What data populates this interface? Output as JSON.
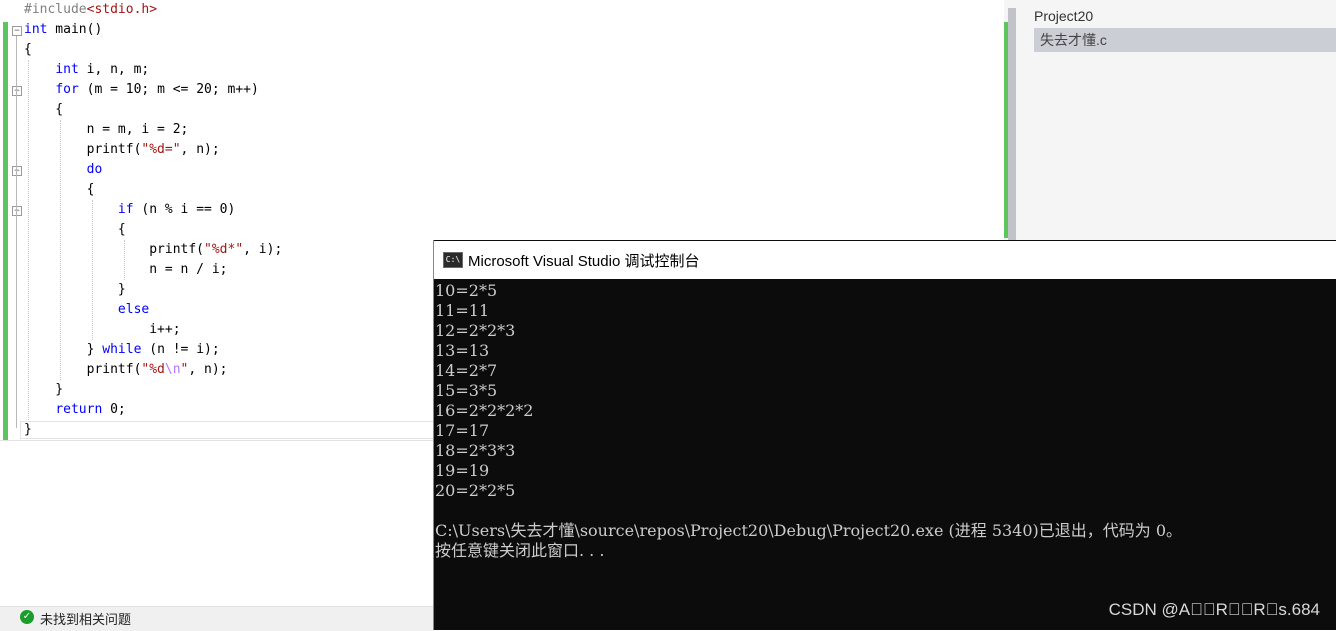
{
  "editor": {
    "lines": [
      [
        {
          "t": "#include",
          "c": "pp"
        },
        {
          "t": "<stdio.h>",
          "c": "inc"
        }
      ],
      [
        {
          "t": "int",
          "c": "kw"
        },
        {
          "t": " main()"
        }
      ],
      [
        {
          "t": "{"
        }
      ],
      [
        {
          "t": "    "
        },
        {
          "t": "int",
          "c": "kw"
        },
        {
          "t": " i, n, m;"
        }
      ],
      [
        {
          "t": "    "
        },
        {
          "t": "for",
          "c": "kw"
        },
        {
          "t": " (m = 10; m <= 20; m++)"
        }
      ],
      [
        {
          "t": "    {"
        }
      ],
      [
        {
          "t": "        n = m, i = 2;"
        }
      ],
      [
        {
          "t": "        printf("
        },
        {
          "t": "\"%d=\"",
          "c": "str"
        },
        {
          "t": ", n);"
        }
      ],
      [
        {
          "t": "        "
        },
        {
          "t": "do",
          "c": "kw"
        }
      ],
      [
        {
          "t": "        {"
        }
      ],
      [
        {
          "t": "            "
        },
        {
          "t": "if",
          "c": "kw"
        },
        {
          "t": " (n % i == 0)"
        }
      ],
      [
        {
          "t": "            {"
        }
      ],
      [
        {
          "t": "                printf("
        },
        {
          "t": "\"%d*\"",
          "c": "str"
        },
        {
          "t": ", i);"
        }
      ],
      [
        {
          "t": "                n = n / i;"
        }
      ],
      [
        {
          "t": "            }"
        }
      ],
      [
        {
          "t": "            "
        },
        {
          "t": "else",
          "c": "kw"
        }
      ],
      [
        {
          "t": "                i++;"
        }
      ],
      [
        {
          "t": "        } "
        },
        {
          "t": "while",
          "c": "kw"
        },
        {
          "t": " (n != i);"
        }
      ],
      [
        {
          "t": "        printf("
        },
        {
          "t": "\"%d",
          "c": "str"
        },
        {
          "t": "\\n",
          "c": "esc"
        },
        {
          "t": "\"",
          "c": "str"
        },
        {
          "t": ", n);"
        }
      ],
      [
        {
          "t": "    }"
        }
      ],
      [
        {
          "t": "    "
        },
        {
          "t": "return",
          "c": "kw"
        },
        {
          "t": " 0;"
        }
      ],
      [
        {
          "t": "}"
        }
      ]
    ]
  },
  "solution": {
    "project": "Project20",
    "file": "失去才懂.c"
  },
  "status": {
    "text": "未找到相关问题"
  },
  "console": {
    "icon": "C:\\",
    "title": "Microsoft Visual Studio 调试控制台",
    "lines": [
      "10=2*5",
      "11=11",
      "12=2*2*3",
      "13=13",
      "14=2*7",
      "15=3*5",
      "16=2*2*2*2",
      "17=17",
      "18=2*3*3",
      "19=19",
      "20=2*2*5",
      "",
      "C:\\Users\\失去才懂\\source\\repos\\Project20\\Debug\\Project20.exe (进程 5340)已退出，代码为 0。",
      "按任意键关闭此窗口. . ."
    ]
  },
  "watermark": "CSDN @A\u0000\u0000R\u0000\u0000R\u0000s.684",
  "colors": {
    "keyword": "#0000ff",
    "string": "#a31515",
    "change_bar": "#5ec45e",
    "console_bg": "#0c0c0c",
    "console_text": "#cccccc"
  },
  "icons": {
    "status": "check-circle-icon",
    "console": "console-app-icon"
  }
}
